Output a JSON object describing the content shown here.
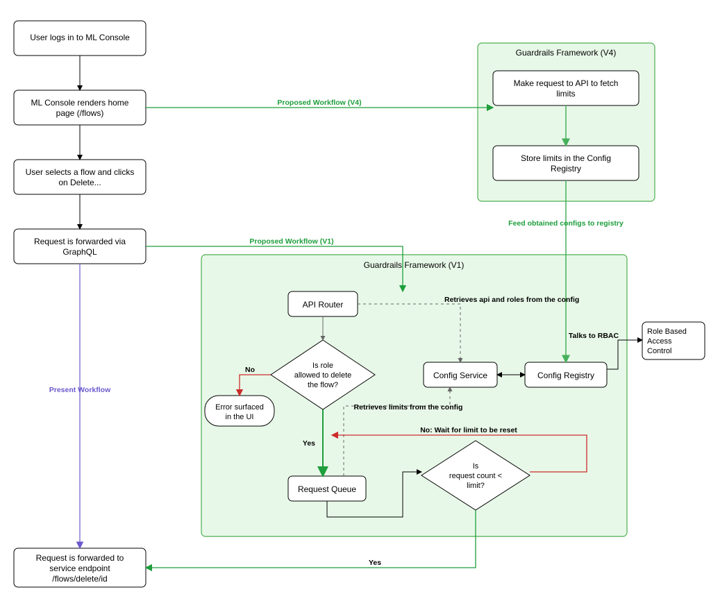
{
  "nodes": {
    "login": {
      "l1": "User logs in to ML Console"
    },
    "home": {
      "l1": "ML Console renders home",
      "l2": "page (/flows)"
    },
    "select": {
      "l1": "User selects a flow and clicks",
      "l2": "on Delete..."
    },
    "graphql": {
      "l1": "Request is forwarded via",
      "l2": "GraphQL"
    },
    "endpoint": {
      "l1": "Request is forwarded to",
      "l2": "service endpoint",
      "l3": "/flows/delete/id"
    },
    "api_fetch": {
      "l1": "Make request to API to fetch",
      "l2": "limits"
    },
    "store_limits": {
      "l1": "Store limits in the Config",
      "l2": "Registry"
    },
    "api_router": {
      "l1": "API Router"
    },
    "role_q": {
      "l1": "Is role",
      "l2": "allowed to delete",
      "l3": "the flow?"
    },
    "error_ui": {
      "l1": "Error surfaced",
      "l2": "in the UI"
    },
    "req_queue": {
      "l1": "Request Queue"
    },
    "cfg_service": {
      "l1": "Config Service"
    },
    "cfg_registry": {
      "l1": "Config Registry"
    },
    "rbac": {
      "l1": "Role Based",
      "l2": "Access",
      "l3": "Control"
    },
    "limit_q": {
      "l1": "Is",
      "l2": "request count <",
      "l3": "limit?"
    }
  },
  "containers": {
    "v4": "Guardrails Framework (V4)",
    "v1": "Guardrails Framework (V1)"
  },
  "edges": {
    "proposed_v4": "Proposed Workflow (V4)",
    "proposed_v1": "Proposed Workflow (V1)",
    "present": "Present Workflow",
    "feed": "Feed obtained configs to registry",
    "retr_api": "Retrieves api and roles from the config",
    "retr_limits": "Retrieves limits from the config",
    "talks_rbac": "Talks to RBAC",
    "no": "No",
    "yes_down": "Yes",
    "no_wait": "No: Wait for limit to be reset",
    "yes_final": "Yes"
  },
  "chart_data": {
    "type": "flowchart",
    "nodes": [
      {
        "id": "login",
        "text": "User logs in to ML Console",
        "shape": "rect"
      },
      {
        "id": "home",
        "text": "ML Console renders home page (/flows)",
        "shape": "rect"
      },
      {
        "id": "select",
        "text": "User selects a flow and clicks on Delete...",
        "shape": "rect"
      },
      {
        "id": "graphql",
        "text": "Request is forwarded via GraphQL",
        "shape": "rect"
      },
      {
        "id": "endpoint",
        "text": "Request is forwarded to service endpoint /flows/delete/id",
        "shape": "rect"
      },
      {
        "id": "api_fetch",
        "text": "Make request to API to fetch limits",
        "shape": "rect",
        "group": "v4"
      },
      {
        "id": "store_limits",
        "text": "Store limits in the Config Registry",
        "shape": "rect",
        "group": "v4"
      },
      {
        "id": "api_router",
        "text": "API Router",
        "shape": "rect",
        "group": "v1"
      },
      {
        "id": "role_q",
        "text": "Is role allowed to delete the flow?",
        "shape": "decision",
        "group": "v1"
      },
      {
        "id": "error_ui",
        "text": "Error surfaced in the UI",
        "shape": "pill",
        "group": "v1"
      },
      {
        "id": "req_queue",
        "text": "Request Queue",
        "shape": "rect",
        "group": "v1"
      },
      {
        "id": "cfg_service",
        "text": "Config Service",
        "shape": "rect",
        "group": "v1"
      },
      {
        "id": "cfg_registry",
        "text": "Config Registry",
        "shape": "rect",
        "group": "v1"
      },
      {
        "id": "rbac",
        "text": "Role Based Access Control",
        "shape": "rect"
      },
      {
        "id": "limit_q",
        "text": "Is request count < limit?",
        "shape": "decision",
        "group": "v1"
      }
    ],
    "groups": [
      {
        "id": "v4",
        "label": "Guardrails Framework (V4)"
      },
      {
        "id": "v1",
        "label": "Guardrails Framework (V1)"
      }
    ],
    "edges": [
      {
        "from": "login",
        "to": "home"
      },
      {
        "from": "home",
        "to": "select"
      },
      {
        "from": "select",
        "to": "graphql"
      },
      {
        "from": "home",
        "to": "api_fetch",
        "label": "Proposed Workflow (V4)",
        "color": "green"
      },
      {
        "from": "graphql",
        "to": "api_router",
        "label": "Proposed Workflow (V1)",
        "color": "green"
      },
      {
        "from": "graphql",
        "to": "endpoint",
        "label": "Present Workflow",
        "color": "purple"
      },
      {
        "from": "api_fetch",
        "to": "store_limits",
        "color": "green"
      },
      {
        "from": "store_limits",
        "to": "cfg_registry",
        "label": "Feed obtained configs to registry",
        "color": "green"
      },
      {
        "from": "api_router",
        "to": "role_q"
      },
      {
        "from": "api_router",
        "to": "cfg_service",
        "label": "Retrieves api and roles from the config",
        "style": "dashed"
      },
      {
        "from": "role_q",
        "to": "error_ui",
        "label": "No",
        "color": "red"
      },
      {
        "from": "role_q",
        "to": "req_queue",
        "label": "Yes",
        "color": "green"
      },
      {
        "from": "req_queue",
        "to": "cfg_service",
        "label": "Retrieves limits from the config",
        "style": "dashed"
      },
      {
        "from": "req_queue",
        "to": "limit_q"
      },
      {
        "from": "limit_q",
        "to": "req_queue",
        "label": "No: Wait for limit to be reset",
        "color": "red"
      },
      {
        "from": "limit_q",
        "to": "endpoint",
        "label": "Yes",
        "color": "green"
      },
      {
        "from": "cfg_service",
        "to": "cfg_registry",
        "bidir": true
      },
      {
        "from": "cfg_registry",
        "to": "rbac",
        "label": "Talks to RBAC"
      }
    ]
  }
}
